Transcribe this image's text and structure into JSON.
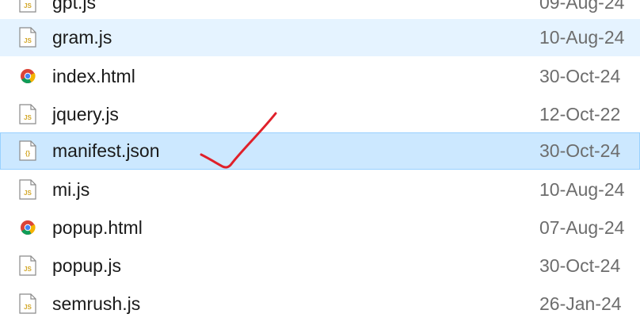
{
  "files": [
    {
      "name": "gpt.js",
      "date": "09-Aug-24",
      "icon": "js-file-icon",
      "state": "normal"
    },
    {
      "name": "gram.js",
      "date": "10-Aug-24",
      "icon": "js-file-icon",
      "state": "hover"
    },
    {
      "name": "index.html",
      "date": "30-Oct-24",
      "icon": "chrome-html-icon",
      "state": "normal"
    },
    {
      "name": "jquery.js",
      "date": "12-Oct-22",
      "icon": "js-file-icon",
      "state": "normal"
    },
    {
      "name": "manifest.json",
      "date": "30-Oct-24",
      "icon": "json-file-icon",
      "state": "selected"
    },
    {
      "name": "mi.js",
      "date": "10-Aug-24",
      "icon": "js-file-icon",
      "state": "normal"
    },
    {
      "name": "popup.html",
      "date": "07-Aug-24",
      "icon": "chrome-html-icon",
      "state": "normal"
    },
    {
      "name": "popup.js",
      "date": "30-Oct-24",
      "icon": "js-file-icon",
      "state": "normal"
    },
    {
      "name": "semrush.js",
      "date": "26-Jan-24",
      "icon": "js-file-icon",
      "state": "normal"
    }
  ],
  "annotation": {
    "icon": "red-checkmark",
    "color": "#e0202a"
  },
  "colors": {
    "hover_bg": "#e5f3ff",
    "selected_bg": "#cce8ff",
    "selected_border": "#99d1ff",
    "js_badge": "#d3a82a",
    "json_badge": "#d3a82a"
  }
}
